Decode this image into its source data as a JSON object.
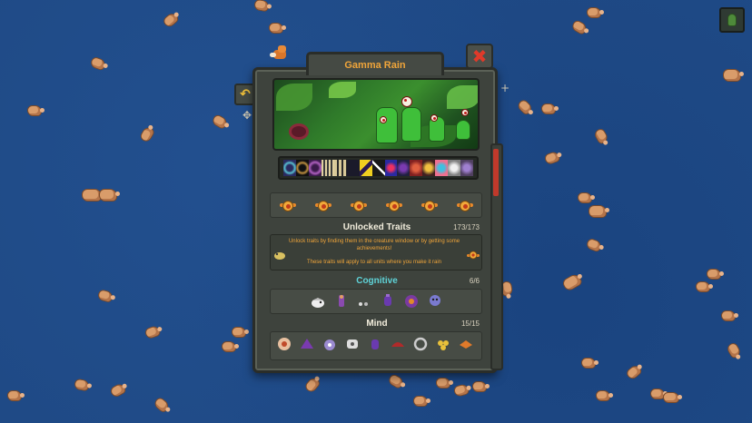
{
  "window": {
    "title": "Gamma Rain",
    "close_icon": "close-icon"
  },
  "achievements": {
    "icon": "achievement-icon",
    "count_shown": 6
  },
  "unlocked_traits": {
    "label": "Unlocked Traits",
    "count": "173/173",
    "info_line1": "Unlock traits by finding them in the creature window or by getting some achievements!",
    "info_line2": "These traits will apply to all units where you make it rain"
  },
  "categories": [
    {
      "label": "Cognitive",
      "count": "6/6"
    },
    {
      "label": "Mind",
      "count": "15/15"
    }
  ],
  "side_buttons": {
    "back_icon": "back-arrow-icon",
    "move_icon": "move-icon",
    "add_icon": "add-icon"
  },
  "corner_button_icon": "spore-icon",
  "colors": {
    "title": "#f0a53a",
    "cyan_heading": "#5fd3d8",
    "close": "#e03a2a",
    "scroll_thumb": "#c0392b",
    "ocean": "#1f4a86"
  }
}
